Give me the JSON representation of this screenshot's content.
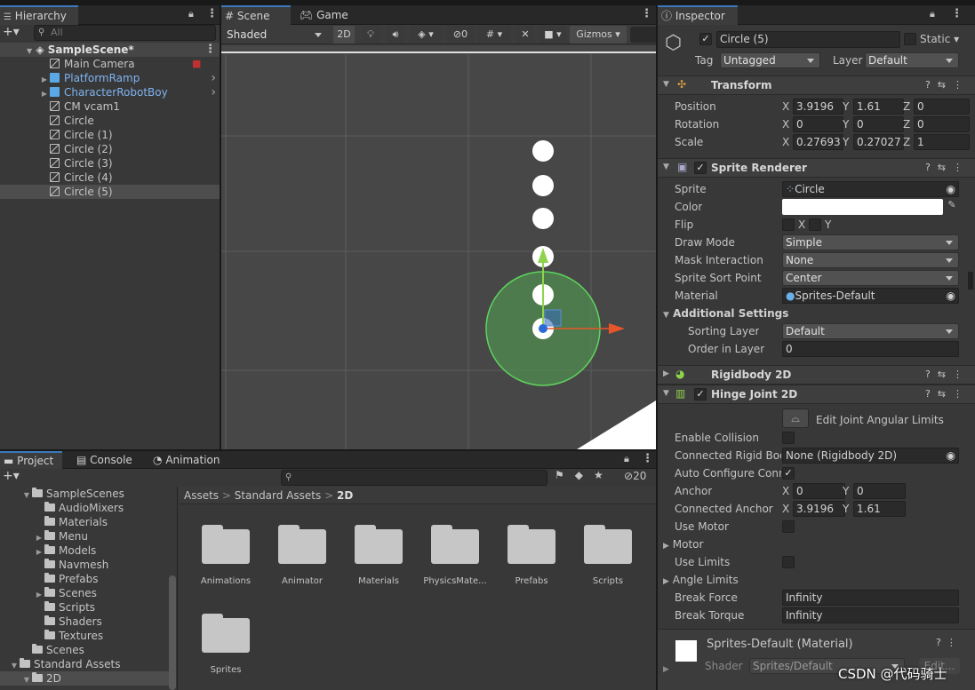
{
  "hierarchy": {
    "tab": "Hierarchy",
    "search_placeholder": "All",
    "scene": "SampleScene*",
    "items": [
      "Main Camera",
      "PlatformRamp",
      "CharacterRobotBoy",
      "CM vcam1",
      "Circle",
      "Circle (1)",
      "Circle (2)",
      "Circle (3)",
      "Circle (4)",
      "Circle (5)"
    ],
    "selected": "Circle (5)"
  },
  "scene": {
    "tabs": [
      "Scene",
      "Game"
    ],
    "shading": "Shaded",
    "mode2d": "2D",
    "hidden_count": "0",
    "gizmos": "Gizmos"
  },
  "project": {
    "tabs": [
      "Project",
      "Console",
      "Animation"
    ],
    "hidden_count": "20",
    "tree": [
      "SampleScenes",
      "AudioMixers",
      "Materials",
      "Menu",
      "Models",
      "Navmesh",
      "Prefabs",
      "Scenes",
      "Scripts",
      "Shaders",
      "Textures",
      "Scenes",
      "Standard Assets",
      "2D"
    ],
    "breadcrumb": [
      "Assets",
      "Standard Assets",
      "2D"
    ],
    "assets": [
      "Animations",
      "Animator",
      "Materials",
      "PhysicsMate...",
      "Prefabs",
      "Scripts",
      "Sprites"
    ]
  },
  "inspector": {
    "tab": "Inspector",
    "object_name": "Circle (5)",
    "static_label": "Static",
    "tag_label": "Tag",
    "tag_value": "Untagged",
    "layer_label": "Layer",
    "layer_value": "Default",
    "transform": {
      "title": "Transform",
      "position_label": "Position",
      "position": [
        "3.9196",
        "1.61",
        "0"
      ],
      "rotation_label": "Rotation",
      "rotation": [
        "0",
        "0",
        "0"
      ],
      "scale_label": "Scale",
      "scale": [
        "0.27693",
        "0.27027",
        "1"
      ]
    },
    "axes": [
      "X",
      "Y",
      "Z"
    ],
    "sprite_renderer": {
      "title": "Sprite Renderer",
      "sprite_label": "Sprite",
      "sprite": "Circle",
      "color_label": "Color",
      "flip_label": "Flip",
      "draw_mode_label": "Draw Mode",
      "draw_mode": "Simple",
      "mask_label": "Mask Interaction",
      "mask": "None",
      "sort_point_label": "Sprite Sort Point",
      "sort_point": "Center",
      "material_label": "Material",
      "material": "Sprites-Default",
      "additional": "Additional Settings",
      "sorting_layer_label": "Sorting Layer",
      "sorting_layer": "Default",
      "order_label": "Order in Layer",
      "order": "0"
    },
    "rigidbody": {
      "title": "Rigidbody 2D"
    },
    "hinge": {
      "title": "Hinge Joint 2D",
      "edit_limits": "Edit Joint Angular Limits",
      "enable_collision": "Enable Collision",
      "connected_rb_label": "Connected Rigid Bod",
      "connected_rb": "None (Rigidbody 2D)",
      "auto_configure": "Auto Configure Conne",
      "anchor_label": "Anchor",
      "anchor": [
        "0",
        "0"
      ],
      "connected_anchor_label": "Connected Anchor",
      "connected_anchor": [
        "3.9196",
        "1.61"
      ],
      "use_motor": "Use Motor",
      "motor": "Motor",
      "use_limits": "Use Limits",
      "angle_limits": "Angle Limits",
      "break_force_label": "Break Force",
      "break_force": "Infinity",
      "break_torque_label": "Break Torque",
      "break_torque": "Infinity"
    },
    "material": {
      "title": "Sprites-Default (Material)",
      "shader_label": "Shader",
      "shader": "Sprites/Default",
      "edit": "Edit..."
    }
  },
  "watermark": "CSDN @代码骑士"
}
